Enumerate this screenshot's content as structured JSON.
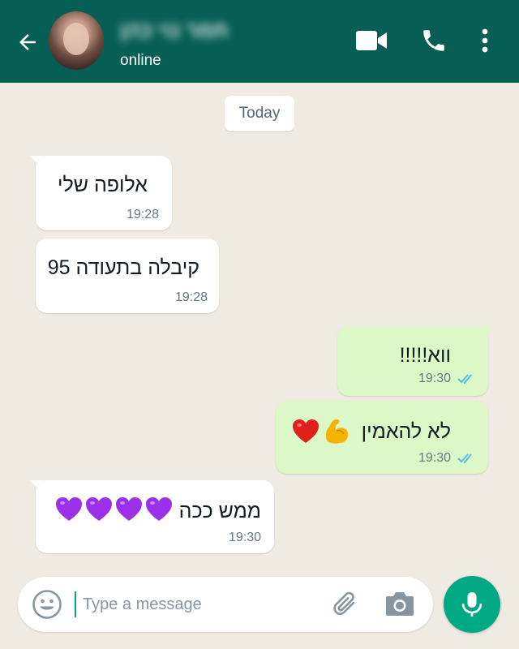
{
  "header": {
    "contact_name": "תמר נוי כהן",
    "status": "online",
    "icons": {
      "back": "back-arrow-icon",
      "video": "video-camera-icon",
      "call": "phone-icon",
      "menu": "more-vertical-icon"
    }
  },
  "chat": {
    "date_label": "Today",
    "messages": [
      {
        "direction": "incoming",
        "text": "אלופה שלי",
        "time": "19:28"
      },
      {
        "direction": "incoming",
        "text": "קיבלה בתעודה 95",
        "time": "19:28"
      },
      {
        "direction": "outgoing",
        "text": "ווא!!!!!",
        "time": "19:30",
        "read": true
      },
      {
        "direction": "outgoing",
        "text": "לא להאמין",
        "emoji": [
          "flexed-biceps",
          "red-heart"
        ],
        "time": "19:30",
        "read": true
      },
      {
        "direction": "incoming",
        "text": "ממש ככה",
        "emoji": [
          "purple-heart",
          "purple-heart",
          "purple-heart",
          "purple-heart"
        ],
        "time": "19:30"
      }
    ]
  },
  "input": {
    "placeholder": "Type a message",
    "value": ""
  },
  "colors": {
    "header_bg": "#075e54",
    "chat_bg": "#efeae2",
    "incoming_bubble": "#ffffff",
    "outgoing_bubble": "#dcf8c6",
    "accent": "#00a884",
    "read_ticks": "#53bdeb"
  }
}
